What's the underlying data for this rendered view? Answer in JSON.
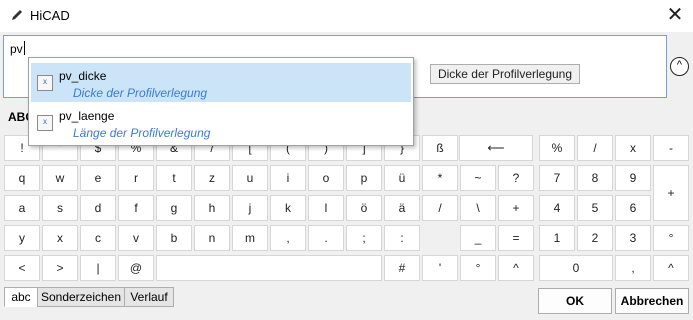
{
  "window": {
    "title": "HiCAD",
    "close_glyph": "✕"
  },
  "input": {
    "value": "pv",
    "hint": "Dicke der Profilverlegung",
    "collapse_glyph": "^"
  },
  "keyboard_group_label_partial": "ABC",
  "autocomplete": [
    {
      "name": "pv_dicke",
      "description": "Dicke der Profilverlegung",
      "selected": true
    },
    {
      "name": "pv_laenge",
      "description": "Länge der Profilverlegung",
      "selected": false
    }
  ],
  "keys": {
    "row1": [
      "!",
      "\"",
      "$",
      "%",
      "&",
      "/",
      "[",
      "(",
      ")",
      "]",
      "}",
      "ß",
      "⟵"
    ],
    "row2": [
      "q",
      "w",
      "e",
      "r",
      "t",
      "z",
      "u",
      "i",
      "o",
      "p",
      "ü",
      "*",
      "~",
      "?"
    ],
    "row3": [
      "a",
      "s",
      "d",
      "f",
      "g",
      "h",
      "j",
      "k",
      "l",
      "ö",
      "ä",
      "/",
      "\\",
      "+"
    ],
    "row4": [
      "y",
      "x",
      "c",
      "v",
      "b",
      "n",
      "m",
      ",",
      ".",
      ";",
      ":",
      "_",
      "="
    ],
    "row5": [
      "<",
      ">",
      "|",
      "@",
      "",
      "#",
      "'",
      "°",
      "^"
    ],
    "numpad": {
      "row1": [
        "%",
        "/",
        "x",
        "-"
      ],
      "row2": [
        "7",
        "8",
        "9"
      ],
      "row3": [
        "4",
        "5",
        "6"
      ],
      "row4": [
        "1",
        "2",
        "3",
        "°"
      ],
      "row5": [
        "0",
        ",",
        "^"
      ],
      "plus": "+"
    }
  },
  "tabs": [
    "abc",
    "Sonderzeichen",
    "Verlauf"
  ],
  "buttons": {
    "ok": "OK",
    "cancel": "Abbrechen"
  },
  "icons": {
    "title": "pencil-icon",
    "close": "close-icon",
    "collapse": "chevron-up-icon",
    "suggestion": "variable-icon"
  }
}
